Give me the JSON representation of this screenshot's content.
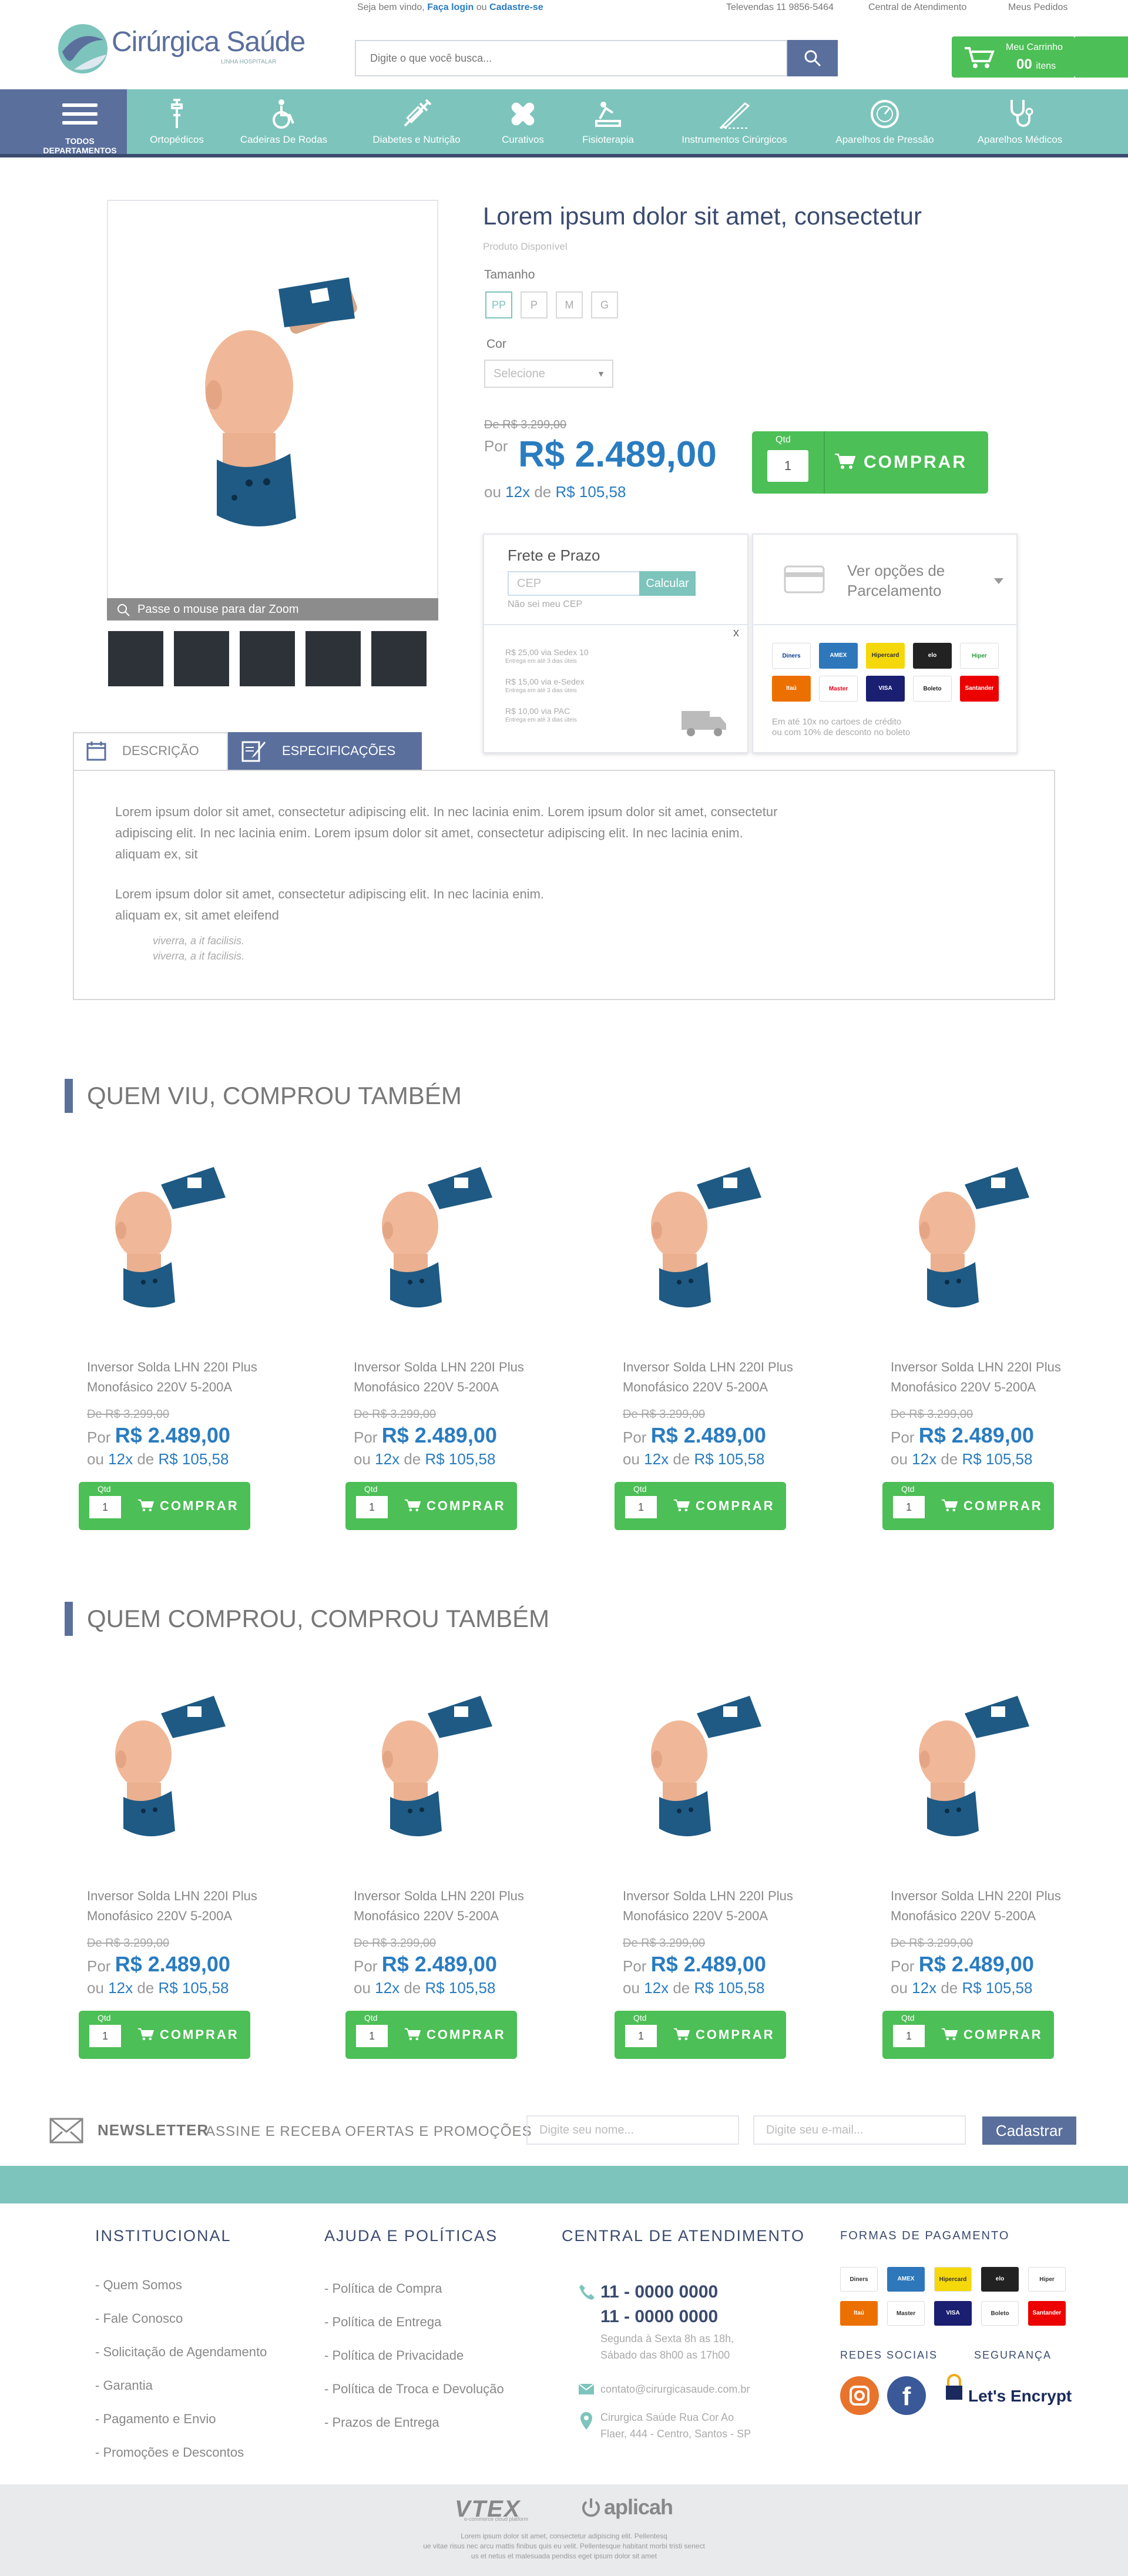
{
  "topbar": {
    "welcome_prefix": "Seja bem vindo,",
    "login": "Faça login",
    "or": "ou",
    "register": "Cadastre-se",
    "phone": "Televendas 11 9856-5464",
    "support": "Central de Atendimento",
    "orders": "Meus Pedidos"
  },
  "header": {
    "logo_text": "Cirúrgica Saúde",
    "logo_sub": "LINHA HOSPITALAR",
    "search_placeholder": "Digite o que você busca...",
    "cart_label": "Meu Carrinho",
    "cart_count": "00",
    "cart_items": "itens"
  },
  "nav": {
    "all_label_1": "TODOS",
    "all_label_2": "DEPARTAMENTOS",
    "items": [
      {
        "label": "Ortopédicos",
        "icon": "crutch-icon"
      },
      {
        "label": "Cadeiras De Rodas",
        "icon": "wheelchair-icon"
      },
      {
        "label": "Diabetes e Nutrição",
        "icon": "syringe-icon"
      },
      {
        "label": "Curativos",
        "icon": "bandage-icon"
      },
      {
        "label": "Fisioterapia",
        "icon": "physio-icon"
      },
      {
        "label": "Instrumentos Cirúrgicos",
        "icon": "scalpel-icon"
      },
      {
        "label": "Aparelhos de Pressão",
        "icon": "gauge-icon"
      },
      {
        "label": "Aparelhos Médicos",
        "icon": "stethoscope-icon"
      }
    ]
  },
  "product": {
    "title": "Lorem ipsum dolor sit amet, consectetur",
    "availability": "Produto Disponível",
    "size_label": "Tamanho",
    "sizes": [
      "PP",
      "P",
      "M",
      "G"
    ],
    "color_label": "Cor",
    "color_placeholder": "Selecione",
    "old_price": "De R$ 3.299,00",
    "price_prefix": "Por",
    "price": "R$ 2.489,00",
    "inst_prefix": "ou",
    "inst_count": "12x",
    "inst_de": "de",
    "inst_value": "R$ 105,58",
    "qty_label": "Qtd",
    "qty": "1",
    "buy_label": "COMPRAR",
    "zoom_hint": "Passe o mouse para dar Zoom"
  },
  "frete": {
    "title": "Frete e Prazo",
    "cep_placeholder": "CEP",
    "calc": "Calcular",
    "dont_know": "Não sei meu CEP",
    "close": "x",
    "options": [
      {
        "price": "R$ 25,00 via Sedex 10",
        "eta": "Entrega em até 3 dias úteis"
      },
      {
        "price": "R$ 15,00 via e-Sedex",
        "eta": "Entrega em até 3 dias úteis"
      },
      {
        "price": "R$ 10,00 via PAC",
        "eta": "Entrega em até 3 dias úteis"
      }
    ]
  },
  "parcelamento": {
    "title_1": "Ver opções de",
    "title_2": "Parcelamento",
    "note_1": "Em até 10x no cartoes de crédito",
    "note_2": "ou com 10% de desconto no boleto"
  },
  "payment_cards": [
    {
      "name": "Diners",
      "color": "#ffffff"
    },
    {
      "name": "AMEX",
      "color": "#2e77bb"
    },
    {
      "name": "Hipercard",
      "color": "#f5d80a"
    },
    {
      "name": "elo",
      "color": "#222222"
    },
    {
      "name": "Hiper",
      "color": "#ffffff"
    },
    {
      "name": "Itaú",
      "color": "#ec7000"
    },
    {
      "name": "Master",
      "color": "#ffffff"
    },
    {
      "name": "VISA",
      "color": "#1a1f71"
    },
    {
      "name": "Boleto",
      "color": "#ffffff"
    },
    {
      "name": "Santander",
      "color": "#ec0000"
    }
  ],
  "tabs": {
    "description": "DESCRIÇÃO",
    "specs": "ESPECIFICAÇÕES"
  },
  "description": {
    "p1_l1": "Lorem ipsum dolor sit amet, consectetur adipiscing elit. In nec lacinia enim. Lorem ipsum dolor sit amet, consectetur",
    "p1_l2": "adipiscing elit. In nec lacinia enim. Lorem ipsum dolor sit amet, consectetur adipiscing elit. In nec lacinia enim.",
    "p1_l3": "aliquam ex, sit",
    "p2_l1": "Lorem ipsum dolor sit amet, consectetur adipiscing elit. In nec lacinia enim.",
    "p2_l2": "aliquam ex, sit amet eleifend",
    "i1": "viverra, a it facilisis.",
    "i2": "viverra, a it facilisis."
  },
  "sections": {
    "s1": "QUEM VIU, COMPROU TAMBÉM",
    "s2": "QUEM COMPROU, COMPROU TAMBÉM"
  },
  "shelf_product": {
    "name": "Inversor Solda LHN 220I Plus Monofásico 220V 5-200A",
    "old_price": "De R$ 3.299,00",
    "por": "Por",
    "price": "R$ 2.489,00",
    "ou": "ou",
    "inst_count": "12x",
    "de": "de",
    "inst_value": "R$ 105,58",
    "qty_label": "Qtd",
    "qty": "1",
    "buy": "COMPRAR"
  },
  "newsletter": {
    "title": "NEWSLETTER",
    "subtitle": "ASSINE E RECEBA OFERTAS E PROMOÇÕES",
    "name_placeholder": "Digite seu nome...",
    "email_placeholder": "Digite seu e-mail...",
    "submit": "Cadastrar"
  },
  "footer": {
    "inst_title": "INSTITUCIONAL",
    "inst_links": [
      "- Quem Somos",
      "- Fale Conosco",
      "- Solicitação de Agendamento",
      "- Garantia",
      "- Pagamento e Envio",
      "- Promoções e Descontos"
    ],
    "help_title": "AJUDA E POLÍTICAS",
    "help_links": [
      "- Política de Compra",
      "- Política de Entrega",
      "- Política de Privacidade",
      "- Política de Troca e Devolução",
      "- Prazos de Entrega"
    ],
    "central_title": "CENTRAL DE ATENDIMENTO",
    "phone1": "11 - 0000 0000",
    "phone2": "11 - 0000 0000",
    "hours1": "Segunda à Sexta 8h as 18h,",
    "hours2": "Sábado das 8h00 as 17h00",
    "email": "contato@cirurgicasaude.com.br",
    "address1": "Cirurgica Saúde Rua Cor Ao",
    "address2": "Flaer, 444 - Centro, Santos - SP",
    "pay_title": "FORMAS DE PAGAMENTO",
    "social_title": "REDES SOCIAIS",
    "security_title": "SEGURANÇA",
    "encrypt": "Let's Encrypt",
    "vtex": "VTEX",
    "vtex_sub": "e-commerce cloud platform",
    "aplicah": "aplicah",
    "legal1": "Lorem ipsum dolor sit amet, consectetur adipiscing elit. Pellentesq",
    "legal2": "ue vitae risus nec arcu mattis finibus quis eu velit. Pellentesque habitant morbi tristi senect",
    "legal3": "us et netus et malesuada pendiss eget ipsum dolor sit amet"
  }
}
